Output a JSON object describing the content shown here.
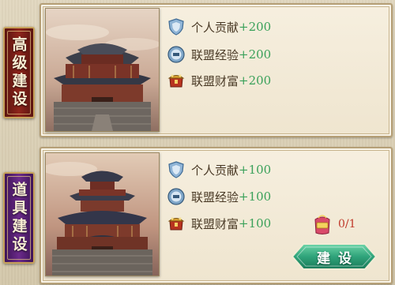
{
  "sections": [
    {
      "tab_label": "高级建设",
      "rewards": [
        {
          "icon": "shield-badge-icon",
          "name": "个人贡献",
          "amount": "+200"
        },
        {
          "icon": "alliance-exp-badge-icon",
          "name": "联盟经验",
          "amount": "+200"
        },
        {
          "icon": "treasure-chest-icon",
          "name": "联盟财富",
          "amount": "+200"
        }
      ]
    },
    {
      "tab_label": "道具建设",
      "rewards": [
        {
          "icon": "shield-badge-icon",
          "name": "个人贡献",
          "amount": "+100"
        },
        {
          "icon": "alliance-exp-badge-icon",
          "name": "联盟经验",
          "amount": "+100"
        },
        {
          "icon": "treasure-chest-icon",
          "name": "联盟财富",
          "amount": "+100"
        }
      ],
      "progress": "0/1",
      "build_button": "建设"
    }
  ],
  "colors": {
    "reward_amount": "#3aa15a",
    "progress_text": "#c0392b",
    "tab_1": "#8e241b",
    "tab_2": "#6b2a8a",
    "button": "#2fa37a"
  }
}
